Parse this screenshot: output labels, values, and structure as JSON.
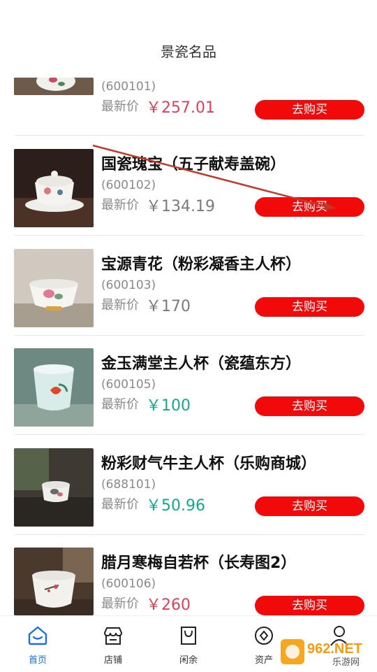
{
  "header": {
    "title": "景瓷名品"
  },
  "products": [
    {
      "name": "",
      "code": "(600101)",
      "price_label": "最新价",
      "price": "￥257.01",
      "price_color": "#d9435a",
      "buy_label": "去购买"
    },
    {
      "name": "国瓷瑰宝（五子献寿盖碗）",
      "code": "(600102)",
      "price_label": "最新价",
      "price": "￥134.19",
      "price_color": "#7a7a7a",
      "buy_label": "去购买"
    },
    {
      "name": "宝源青花（粉彩凝香主人杯）",
      "code": "(600103)",
      "price_label": "最新价",
      "price": "￥170",
      "price_color": "#7a7a7a",
      "buy_label": "去购买"
    },
    {
      "name": "金玉满堂主人杯（瓷蕴东方）",
      "code": "(600105)",
      "price_label": "最新价",
      "price": "￥100",
      "price_color": "#17a88a",
      "buy_label": "去购买"
    },
    {
      "name": "粉彩财气牛主人杯（乐购商城）",
      "code": "(688101)",
      "price_label": "最新价",
      "price": "￥50.96",
      "price_color": "#17a88a",
      "buy_label": "去购买"
    },
    {
      "name": "腊月寒梅自若杯（长寿图2）",
      "code": "(600106)",
      "price_label": "最新价",
      "price": "￥260",
      "price_color": "#d9435a",
      "buy_label": "去购买"
    }
  ],
  "tabbar": {
    "items": [
      {
        "label": "首页",
        "icon": "home-icon",
        "active": true
      },
      {
        "label": "店铺",
        "icon": "store-icon",
        "active": false
      },
      {
        "label": "闲余",
        "icon": "bag-icon",
        "active": false
      },
      {
        "label": "资产",
        "icon": "assets-icon",
        "active": false
      },
      {
        "label": "",
        "icon": "user-icon",
        "active": false
      }
    ]
  },
  "watermark": {
    "text": "962.NET",
    "subtext": "乐游网"
  },
  "colors": {
    "buy_button": "#f20a0a",
    "active_tab": "#1e6fd9",
    "price_red": "#d9435a",
    "price_green": "#17a88a",
    "price_gray": "#7a7a7a"
  }
}
